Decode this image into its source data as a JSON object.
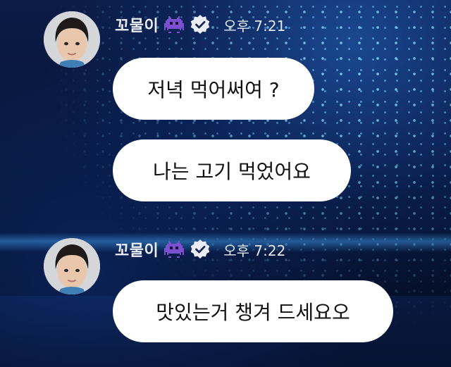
{
  "messages": [
    {
      "sender": "꼬물이",
      "sender_emoji": "👾",
      "time": "오후 7:21",
      "bubbles": [
        "저녁 먹어써여 ?",
        "나는 고기 먹었어요"
      ]
    },
    {
      "sender": "꼬물이",
      "sender_emoji": "👾",
      "time": "오후 7:22",
      "bubbles": [
        "맛있는거 챙겨 드세요오"
      ]
    }
  ],
  "colors": {
    "bubble": "#ffffff",
    "meta_text": "#e9ecf3",
    "alien_icon": "#7a4fd0",
    "verified_badge": "#e9ecf3"
  },
  "icons": [
    "alien-monster-icon",
    "verified-badge-icon"
  ]
}
